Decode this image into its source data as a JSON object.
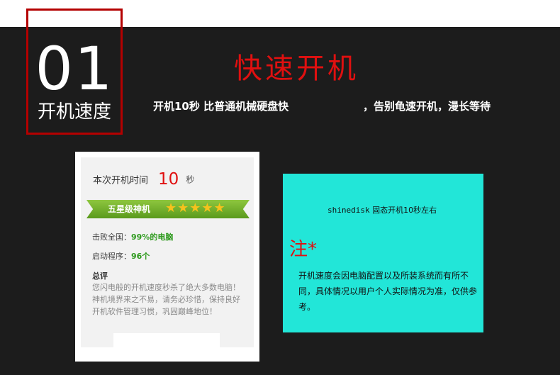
{
  "section": {
    "number": "01",
    "label": "开机速度",
    "title": "快速开机",
    "subtitle_left": "开机10秒 比普通机械硬盘快",
    "subtitle_right": "，告别龟速开机，漫长等待"
  },
  "boot_card": {
    "time_label": "本次开机时间",
    "time_value": "10",
    "time_unit": "秒",
    "rating_label": "五星级神机",
    "rating_stars": 5,
    "stars_glyphs": "★★★★★",
    "beat_label": "击败全国：",
    "beat_value": "99%的电脑",
    "startup_label": "启动程序：",
    "startup_value": "96个",
    "summary_title": "总评",
    "summary_body": "您闪电般的开机速度秒杀了绝大多数电脑！神机境界来之不易，请务必珍惜，保持良好开机软件管理习惯，巩固巅峰地位！"
  },
  "note_box": {
    "title_mono": "shinedisk",
    "title_rest": " 固态开机10秒左右",
    "note_mark": "注*",
    "note_body": "开机速度会因电脑配置以及所装系统而有所不同，具体情况以用户个人实际情况为准，仅供参考。"
  },
  "colors": {
    "accent_red": "#e01010",
    "border_red": "#b40000",
    "dark_bg": "#1c1c1c",
    "cyan": "#22e6d8",
    "ribbon_green": "#6aaa2a"
  }
}
